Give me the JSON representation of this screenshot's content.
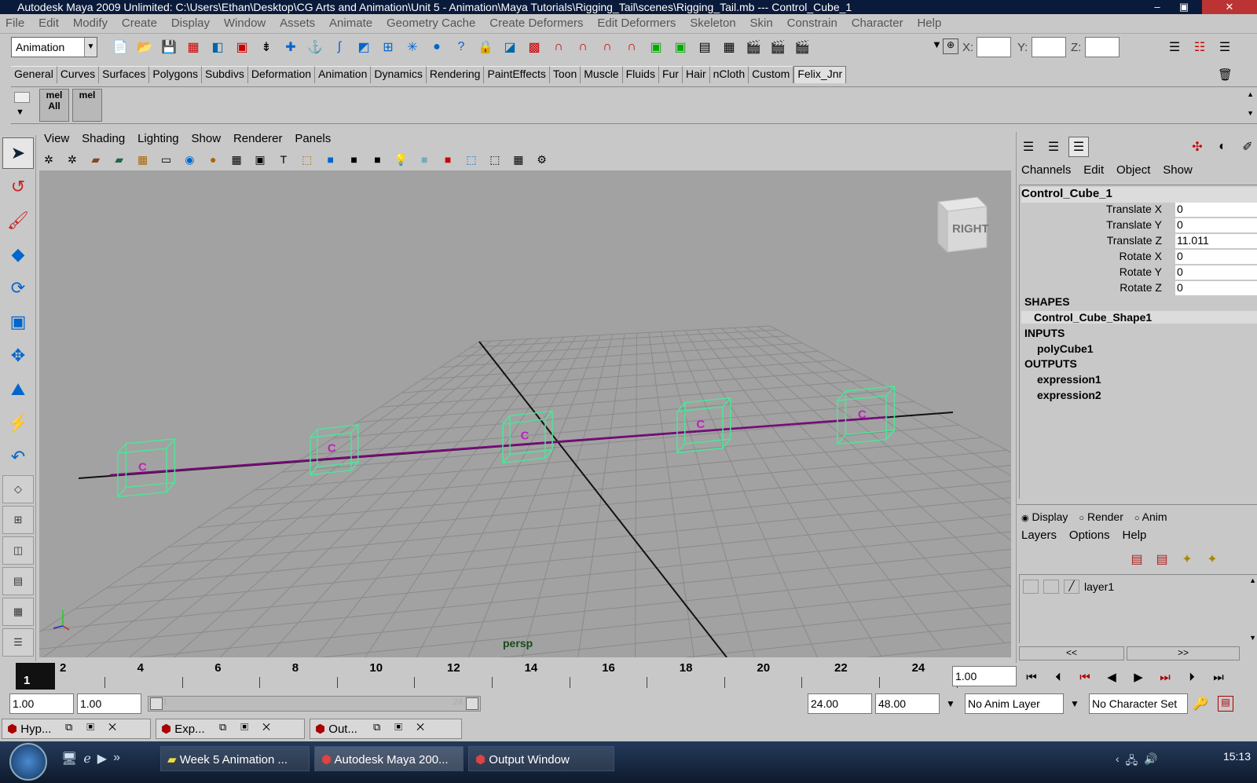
{
  "window": {
    "title": "Autodesk Maya 2009 Unlimited: C:\\Users\\Ethan\\Desktop\\CG Arts and Animation\\Unit 5 - Animation\\Maya Tutorials\\Rigging_Tail\\scenes\\Rigging_Tail.mb  ---  Control_Cube_1",
    "minimize": "–",
    "maximize": "▣",
    "close": "✕"
  },
  "menubar": [
    "File",
    "Edit",
    "Modify",
    "Create",
    "Display",
    "Window",
    "Assets",
    "Animate",
    "Geometry Cache",
    "Create Deformers",
    "Edit Deformers",
    "Skeleton",
    "Skin",
    "Constrain",
    "Character",
    "Help"
  ],
  "statusline": {
    "mode": "Animation",
    "x_label": "X:",
    "y_label": "Y:",
    "z_label": "Z:"
  },
  "shelf_tabs": [
    "General",
    "Curves",
    "Surfaces",
    "Polygons",
    "Subdivs",
    "Deformation",
    "Animation",
    "Dynamics",
    "Rendering",
    "PaintEffects",
    "Toon",
    "Muscle",
    "Fluids",
    "Fur",
    "Hair",
    "nCloth",
    "Custom",
    "Felix_Jnr"
  ],
  "shelf": {
    "mel1": "mel",
    "mel2": "mel",
    "all_label": "All"
  },
  "panel_menu": [
    "View",
    "Shading",
    "Lighting",
    "Show",
    "Renderer",
    "Panels"
  ],
  "viewport": {
    "camera_label": "persp",
    "view_cube_label": "RIGHT",
    "control_cube_label": "C"
  },
  "channel_box": {
    "menu": [
      "Channels",
      "Edit",
      "Object",
      "Show"
    ],
    "object_name": "Control_Cube_1",
    "attributes": [
      {
        "name": "Translate X",
        "value": "0"
      },
      {
        "name": "Translate Y",
        "value": "0"
      },
      {
        "name": "Translate Z",
        "value": "11.011"
      },
      {
        "name": "Rotate X",
        "value": "0"
      },
      {
        "name": "Rotate Y",
        "value": "0"
      },
      {
        "name": "Rotate Z",
        "value": "0"
      }
    ],
    "shapes_header": "SHAPES",
    "shape_name": "Control_Cube_Shape1",
    "inputs_header": "INPUTS",
    "input_name": "polyCube1",
    "outputs_header": "OUTPUTS",
    "outputs": [
      "expression1",
      "expression2"
    ]
  },
  "layer_editor": {
    "radio_display": "Display",
    "radio_render": "Render",
    "radio_anim": "Anim",
    "menu": [
      "Layers",
      "Options",
      "Help"
    ],
    "layer_name": "layer1",
    "scroll_left": "<<",
    "scroll_right": ">>"
  },
  "timeline": {
    "current_frame": "1",
    "tick_labels": [
      "2",
      "4",
      "6",
      "8",
      "10",
      "12",
      "14",
      "16",
      "18",
      "20",
      "22",
      "24"
    ],
    "current_time_field": "1.00"
  },
  "range": {
    "start_time": "1.00",
    "playback_start": "1.00",
    "playback_end": "24.00",
    "end_time": "48.00",
    "anim_layer": "No Anim Layer",
    "character_set": "No Character Set",
    "slider_start": "1",
    "slider_end": "24"
  },
  "minimized_windows": [
    "Hyp...",
    "Exp...",
    "Out..."
  ],
  "taskbar": {
    "tasks": [
      "Week 5 Animation ...",
      "Autodesk Maya 200...",
      "Output Window"
    ],
    "clock": "15:13"
  },
  "colors": {
    "viewport_bg": "#a2a2a2",
    "grid": "#8a8a8a",
    "curve": "#7a0a7a",
    "cube_wire": "#4fe39a",
    "cube_label": "#c020c0"
  }
}
